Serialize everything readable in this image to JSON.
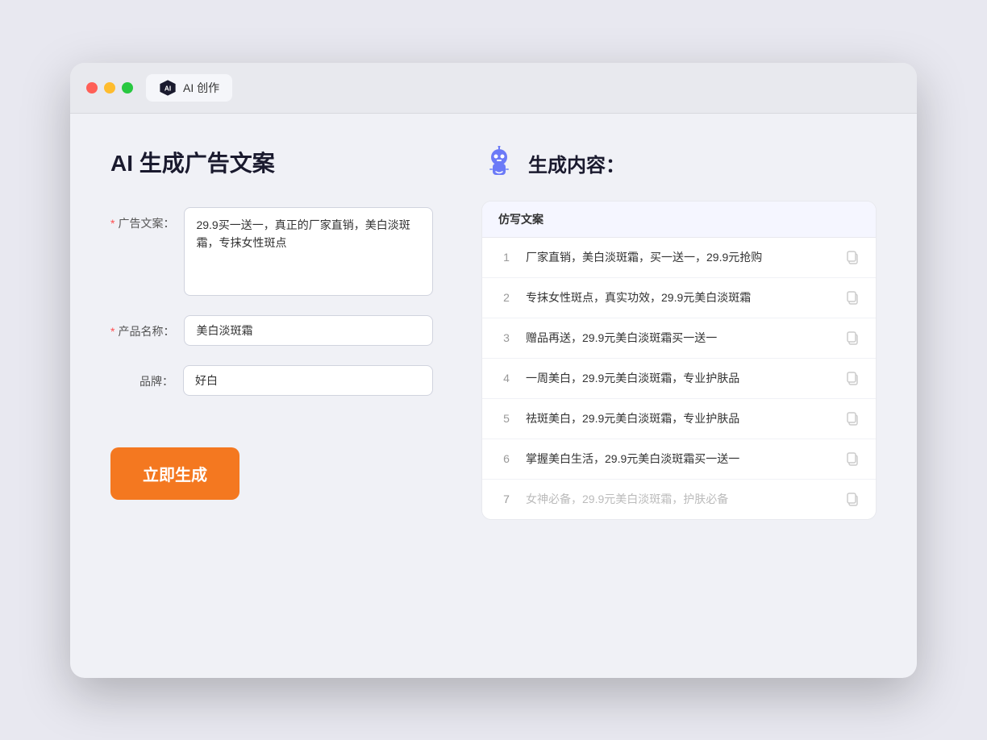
{
  "browser": {
    "tab_label": "AI 创作"
  },
  "left": {
    "title": "AI 生成广告文案",
    "ad_copy_label": "广告文案：",
    "ad_copy_required": "*",
    "ad_copy_value": "29.9买一送一，真正的厂家直销，美白淡斑霜，专抹女性斑点",
    "product_name_label": "产品名称：",
    "product_name_required": "*",
    "product_name_value": "美白淡斑霜",
    "brand_label": "品牌：",
    "brand_value": "好白",
    "generate_btn": "立即生成"
  },
  "right": {
    "title": "生成内容：",
    "table_header": "仿写文案",
    "results": [
      {
        "num": "1",
        "text": "厂家直销，美白淡斑霜，买一送一，29.9元抢购",
        "muted": false
      },
      {
        "num": "2",
        "text": "专抹女性斑点，真实功效，29.9元美白淡斑霜",
        "muted": false
      },
      {
        "num": "3",
        "text": "赠品再送，29.9元美白淡斑霜买一送一",
        "muted": false
      },
      {
        "num": "4",
        "text": "一周美白，29.9元美白淡斑霜，专业护肤品",
        "muted": false
      },
      {
        "num": "5",
        "text": "祛斑美白，29.9元美白淡斑霜，专业护肤品",
        "muted": false
      },
      {
        "num": "6",
        "text": "掌握美白生活，29.9元美白淡斑霜买一送一",
        "muted": false
      },
      {
        "num": "7",
        "text": "女神必备，29.9元美白淡斑霜，护肤必备",
        "muted": true
      }
    ]
  }
}
